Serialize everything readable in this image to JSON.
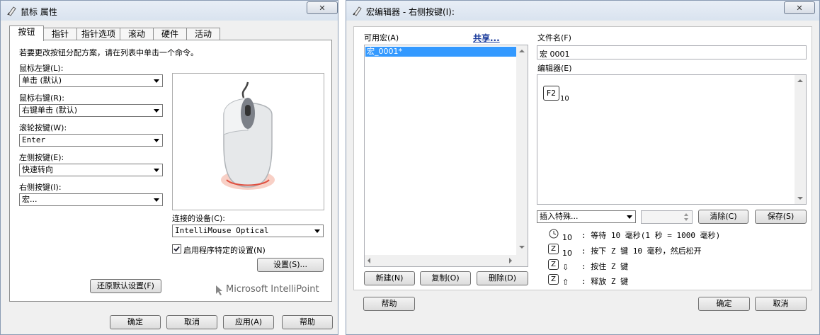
{
  "mouse_window": {
    "title": "鼠标 属性",
    "close_label": "✕",
    "tabs": [
      "按钮",
      "指针",
      "指针选项",
      "滚动",
      "硬件",
      "活动"
    ],
    "instruction": "若要更改按钮分配方案，请在列表中单击一个命令。",
    "left_button": {
      "label": "鼠标左键(L):",
      "value": "单击 (默认)"
    },
    "right_button": {
      "label": "鼠标右键(R):",
      "value": "右键单击 (默认)"
    },
    "wheel_button": {
      "label": "滚轮按键(W):",
      "value": "Enter"
    },
    "left_side_button": {
      "label": "左侧按键(E):",
      "value": "快速转向"
    },
    "right_side_button": {
      "label": "右侧按键(I):",
      "value": "宏..."
    },
    "device_label": "连接的设备(C):",
    "device_value": "IntelliMouse Optical",
    "app_specific_label": "启用程序特定的设置(N)",
    "app_specific_checked": true,
    "settings_button": "设置(S)...",
    "restore_defaults_button": "还原默认设置(F)",
    "brand_logo": "Microsoft IntelliPoint",
    "ok_button": "确定",
    "cancel_button": "取消",
    "apply_button": "应用(A)",
    "help_button": "帮助"
  },
  "macro_window": {
    "title": "宏编辑器 - 右侧按键(I):",
    "close_label": "✕",
    "available_label": "可用宏(A)",
    "share_link": "共享...",
    "macro_list": [
      "宏_0001*"
    ],
    "filename_label": "文件名(F)",
    "filename_value": "宏 0001",
    "editor_label": "编辑器(E)",
    "editor_key": "F2",
    "editor_key_delay": "10",
    "insert_special": "插入特殊...",
    "clear_button": "清除(C)",
    "save_button": "保存(S)",
    "legend": [
      {
        "icon": "clock-icon",
        "num": "10",
        "text": ": 等待 10 毫秒(1 秒 = 1000 毫秒)"
      },
      {
        "icon": "key-z-icon",
        "num": "10",
        "text": ": 按下 Z 键 10 毫秒，然后松开"
      },
      {
        "icon": "key-z-down-icon",
        "num": "⇩",
        "text": ": 按住 Z 键"
      },
      {
        "icon": "key-z-up-icon",
        "num": "⇧",
        "text": ": 释放 Z 键"
      }
    ],
    "legend_key": "Z",
    "new_button": "新建(N)",
    "copy_button": "复制(O)",
    "delete_button": "删除(D)",
    "help_button": "帮助",
    "ok_button": "确定",
    "cancel_button": "取消"
  }
}
